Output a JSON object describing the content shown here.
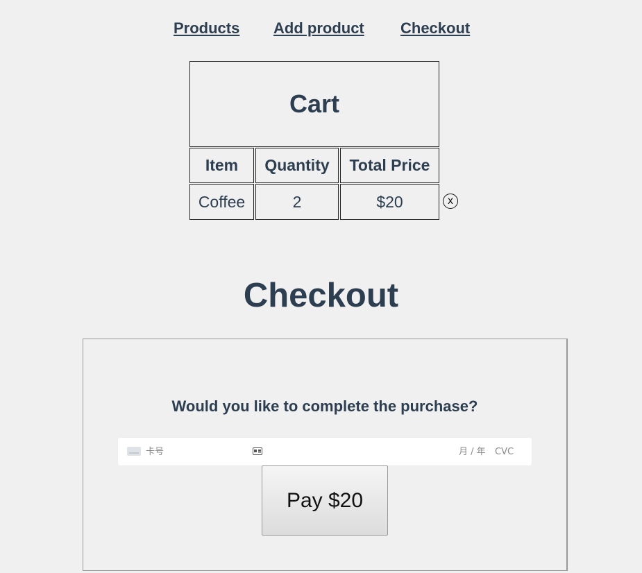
{
  "nav": {
    "products": "Products",
    "add_product": "Add product",
    "checkout": "Checkout"
  },
  "cart": {
    "title": "Cart",
    "headers": [
      "Item",
      "Quantity",
      "Total Price"
    ],
    "rows": [
      {
        "item": "Coffee",
        "quantity": "2",
        "total": "$20",
        "remove_label": "x"
      }
    ]
  },
  "checkout": {
    "title": "Checkout",
    "question": "Would you like to complete the purchase?",
    "card": {
      "number_placeholder": "卡号",
      "expiry_placeholder": "月 / 年",
      "cvc_placeholder": "CVC"
    },
    "pay_label": "Pay $20"
  },
  "colors": {
    "text": "#2c3e50",
    "background": "#f0f0f0"
  }
}
